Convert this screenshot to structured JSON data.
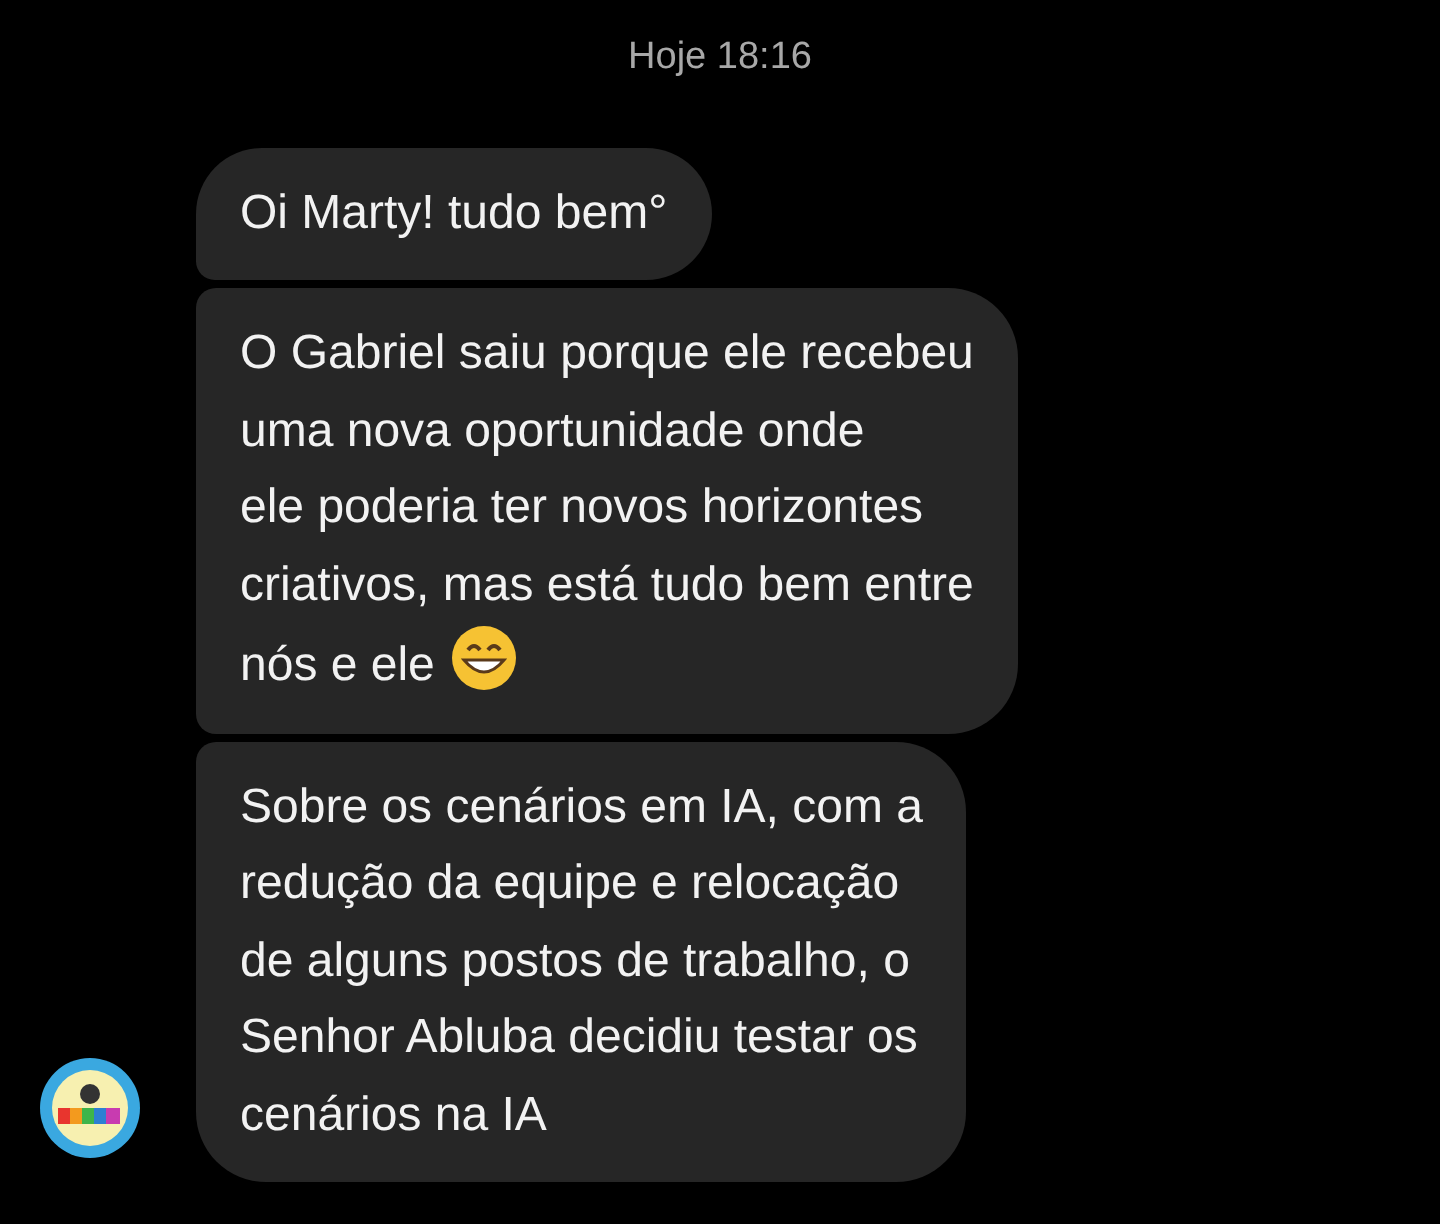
{
  "timestamp": "Hoje 18:16",
  "messages": [
    {
      "lines": [
        "Oi Marty! tudo bem°"
      ],
      "emoji": false
    },
    {
      "lines": [
        "O Gabriel saiu porque ele recebeu",
        "uma nova oportunidade onde",
        "ele poderia ter novos horizontes",
        "criativos, mas está tudo bem entre",
        "nós e ele"
      ],
      "emoji": true
    },
    {
      "lines": [
        "Sobre os cenários em IA, com a",
        "redução da equipe e relocação",
        "de alguns postos de trabalho, o",
        "Senhor Abluba decidiu testar os",
        "cenários na IA"
      ],
      "emoji": false
    }
  ]
}
